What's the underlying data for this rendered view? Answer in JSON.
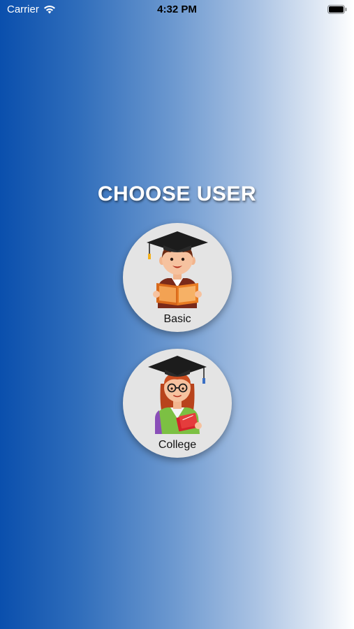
{
  "status_bar": {
    "carrier": "Carrier",
    "time": "4:32 PM",
    "icons": [
      "wifi-icon",
      "battery-icon"
    ]
  },
  "screen": {
    "title": "CHOOSE USER",
    "background_gradient": [
      "#0a4fad",
      "#ffffff"
    ]
  },
  "options": [
    {
      "label": "Basic",
      "icon": "boy-student-graduation-cap-icon"
    },
    {
      "label": "College",
      "icon": "girl-student-graduation-cap-icon"
    }
  ],
  "colors": {
    "title": "#ffffff",
    "circle": "#e4e4e4",
    "label": "#111111"
  }
}
